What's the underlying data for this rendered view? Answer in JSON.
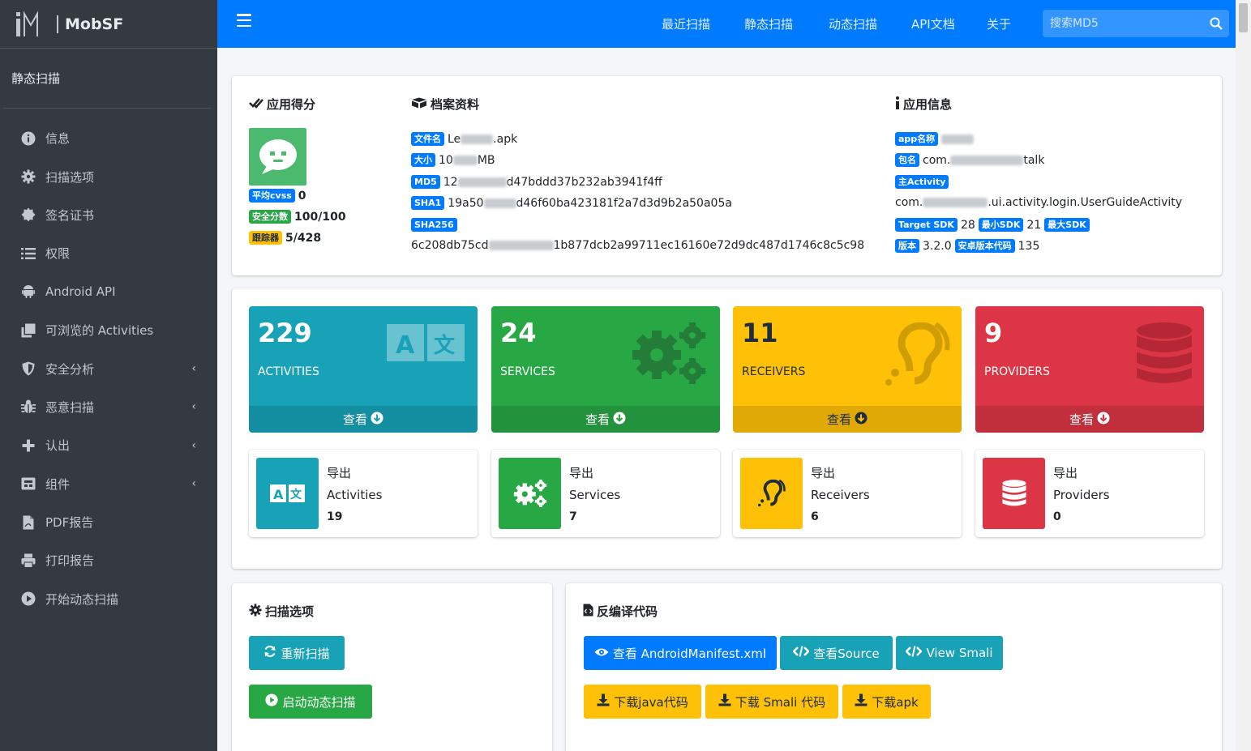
{
  "brand": {
    "name": "MobSF"
  },
  "sidebar": {
    "section_title": "静态扫描",
    "items": [
      {
        "label": "信息",
        "icon": "info-circle-icon"
      },
      {
        "label": "扫描选项",
        "icon": "cog-icon"
      },
      {
        "label": "签名证书",
        "icon": "certificate-icon"
      },
      {
        "label": "权限",
        "icon": "list-icon"
      },
      {
        "label": "Android API",
        "icon": "android-icon"
      },
      {
        "label": "可浏览的 Activities",
        "icon": "clone-icon"
      },
      {
        "label": "安全分析",
        "icon": "shield-icon",
        "chevron": "‹"
      },
      {
        "label": "恶意扫描",
        "icon": "bug-icon",
        "chevron": "‹"
      },
      {
        "label": "认出",
        "icon": "plus-icon",
        "chevron": "‹"
      },
      {
        "label": "组件",
        "icon": "components-icon",
        "chevron": "‹"
      },
      {
        "label": "PDF报告",
        "icon": "file-pdf-icon"
      },
      {
        "label": "打印报告",
        "icon": "print-icon"
      },
      {
        "label": "开始动态扫描",
        "icon": "play-circle-icon"
      }
    ]
  },
  "navbar": {
    "links": [
      "最近扫描",
      "静态扫描",
      "动态扫描",
      "API文档",
      "关于"
    ],
    "search_placeholder": "搜索MD5"
  },
  "score": {
    "title": "应用得分",
    "cvss_label": "平均cvss",
    "cvss_value": "0",
    "security_label": "安全分数",
    "security_value": "100/100",
    "tracker_label": "跟踪器",
    "tracker_value": "5/428"
  },
  "profile": {
    "title": "档案资料",
    "filename_label": "文件名",
    "filename_prefix": "Le",
    "filename_suffix": ".apk",
    "size_label": "大小",
    "size_prefix": "10",
    "size_suffix": "MB",
    "md5_label": "MD5",
    "md5_prefix": "12",
    "md5_suffix": "d47bddd37b232ab3941f4ff",
    "sha1_label": "SHA1",
    "sha1_prefix": "19a50",
    "sha1_suffix": "d46f60ba423181f2a7d3d9b2a50a05a",
    "sha256_label": "SHA256",
    "sha256_prefix": "6c208db75cd",
    "sha256_suffix": "1b877dcb2a99711ec16160e72d9dc487d1746c8c5c98"
  },
  "app_info": {
    "title": "应用信息",
    "app_name_label": "app名称",
    "package_label": "包名",
    "package_prefix": "com.",
    "package_suffix": "talk",
    "main_activity_label": "主Activity",
    "main_activity_prefix": "com.",
    "main_activity_suffix": ".ui.activity.login.UserGuideActivity",
    "target_sdk_label": "Target SDK",
    "target_sdk": "28",
    "min_sdk_label": "最小SDK",
    "min_sdk": "21",
    "max_sdk_label": "最大SDK",
    "version_label": "版本",
    "version": "3.2.0",
    "version_code_label": "安卓版本代码",
    "version_code": "135"
  },
  "stats": [
    {
      "count": "229",
      "label": "ACTIVITIES",
      "view": "查看",
      "color": "#17a2b8"
    },
    {
      "count": "24",
      "label": "SERVICES",
      "view": "查看",
      "color": "#28a745"
    },
    {
      "count": "11",
      "label": "RECEIVERS",
      "view": "查看",
      "color": "#ffc107"
    },
    {
      "count": "9",
      "label": "PROVIDERS",
      "view": "查看",
      "color": "#dc3545"
    }
  ],
  "exported": [
    {
      "title": "导出",
      "name": "Activities",
      "count": "19"
    },
    {
      "title": "导出",
      "name": "Services",
      "count": "7"
    },
    {
      "title": "导出",
      "name": "Receivers",
      "count": "6"
    },
    {
      "title": "导出",
      "name": "Providers",
      "count": "0"
    }
  ],
  "scan_options": {
    "title": "扫描选项",
    "rescan": "重新扫描",
    "start_dynamic": "启动动态扫描"
  },
  "decompiled": {
    "title": "反编译代码",
    "view_manifest": "查看 AndroidManifest.xml",
    "view_source": "查看Source",
    "view_smali": "View Smali",
    "download_java": "下载java代码",
    "download_smali": "下载 Smali 代码",
    "download_apk": "下载apk"
  }
}
